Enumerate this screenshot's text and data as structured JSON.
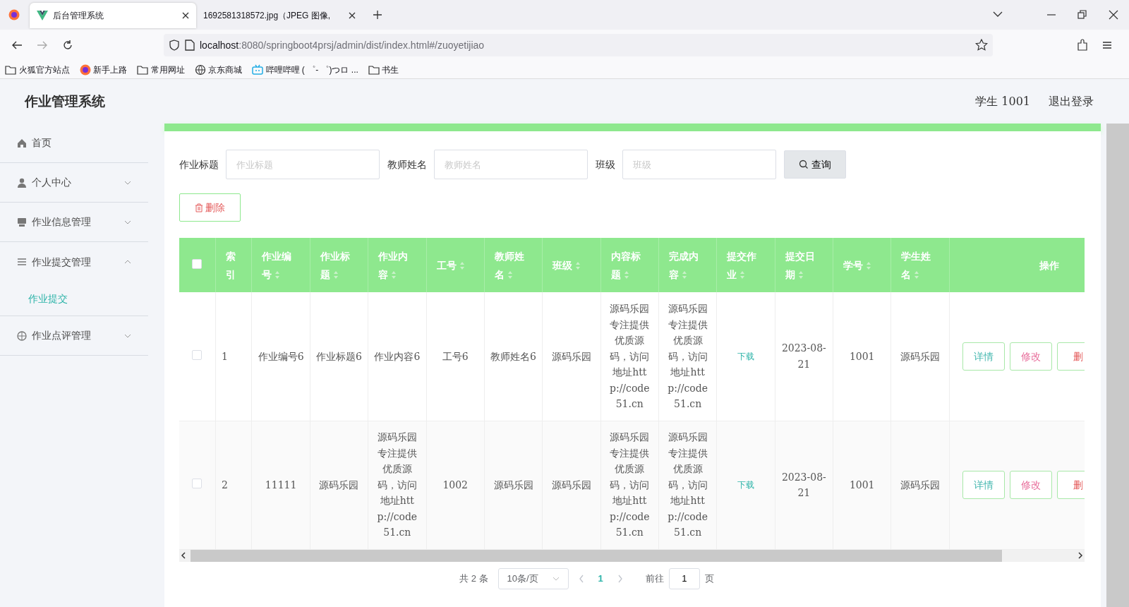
{
  "browser": {
    "tabs": [
      {
        "title": "后台管理系统",
        "selected": true,
        "kind": "vue"
      },
      {
        "title": "1692581318572.jpg（JPEG 图像,",
        "selected": false,
        "kind": "image"
      }
    ],
    "url_host": "localhost",
    "url_rest": ":8080/springboot4prsj/admin/dist/index.html#/zuoyetijiao",
    "bookmarks": [
      {
        "label": "火狐官方站点",
        "kind": "folder"
      },
      {
        "label": "新手上路",
        "kind": "firefox"
      },
      {
        "label": "常用网址",
        "kind": "folder"
      },
      {
        "label": "京东商城",
        "kind": "globe"
      },
      {
        "label": "哔哩哔哩 ( ゜- ゜)つロ ...",
        "kind": "tv"
      },
      {
        "label": "书生",
        "kind": "folder"
      }
    ]
  },
  "app": {
    "title": "作业管理系统",
    "user": "学生 1001",
    "logout": "退出登录"
  },
  "sidebar": {
    "items": [
      {
        "label": "首页",
        "kind": "link"
      },
      {
        "label": "个人中心",
        "kind": "menu",
        "expanded": false
      },
      {
        "label": "作业信息管理",
        "kind": "menu",
        "expanded": false
      },
      {
        "label": "作业提交管理",
        "kind": "menu",
        "expanded": true,
        "children": [
          {
            "label": "作业提交",
            "selected": true
          }
        ]
      },
      {
        "label": "作业点评管理",
        "kind": "menu",
        "expanded": false
      }
    ]
  },
  "search": {
    "fields": [
      {
        "label": "作业标题",
        "placeholder": "作业标题"
      },
      {
        "label": "教师姓名",
        "placeholder": "教师姓名"
      },
      {
        "label": "班级",
        "placeholder": "班级"
      }
    ],
    "button": "查询"
  },
  "delete_button": "删除",
  "table": {
    "select_all": {
      "checked": false
    },
    "columns": [
      {
        "label": "索引",
        "sortable": false
      },
      {
        "label": "作业编号",
        "sortable": true
      },
      {
        "label": "作业标题",
        "sortable": true
      },
      {
        "label": "作业内容",
        "sortable": true
      },
      {
        "label": "工号",
        "sortable": true
      },
      {
        "label": "教师姓名",
        "sortable": true
      },
      {
        "label": "班级",
        "sortable": true
      },
      {
        "label": "内容标题",
        "sortable": true
      },
      {
        "label": "完成内容",
        "sortable": true
      },
      {
        "label": "提交作业",
        "sortable": true
      },
      {
        "label": "提交日期",
        "sortable": true
      },
      {
        "label": "学号",
        "sortable": true
      },
      {
        "label": "学生姓名",
        "sortable": true
      },
      {
        "label": "操作",
        "sortable": false
      }
    ],
    "rows": [
      {
        "checked": false,
        "cells": [
          "1",
          "作业编号6",
          "作业标题6",
          "作业内容6",
          "工号6",
          "教师姓名6",
          "源码乐园",
          "源码乐园专注提供优质源码，访问地址http://code51.cn",
          "源码乐园专注提供优质源码，访问地址http://code51.cn",
          "下载",
          "2023-08-21",
          "1001",
          "源码乐园"
        ],
        "actions": [
          "详情",
          "修改",
          "删"
        ]
      },
      {
        "checked": false,
        "cells": [
          "2",
          "11111",
          "源码乐园",
          "源码乐园专注提供优质源码，访问地址http://code51.cn",
          "1002",
          "源码乐园",
          "源码乐园",
          "源码乐园专注提供优质源码，访问地址http://code51.cn",
          "源码乐园专注提供优质源码，访问地址http://code51.cn",
          "下载",
          "2023-08-21",
          "1001",
          "源码乐园"
        ],
        "actions": [
          "详情",
          "修改",
          "删"
        ]
      }
    ]
  },
  "pagination": {
    "total": "共 2 条",
    "page_size": "10条/页",
    "pages": [
      {
        "label": "1",
        "selected": true
      }
    ],
    "goto": "前往",
    "goto_value": "1",
    "unit": "页"
  }
}
